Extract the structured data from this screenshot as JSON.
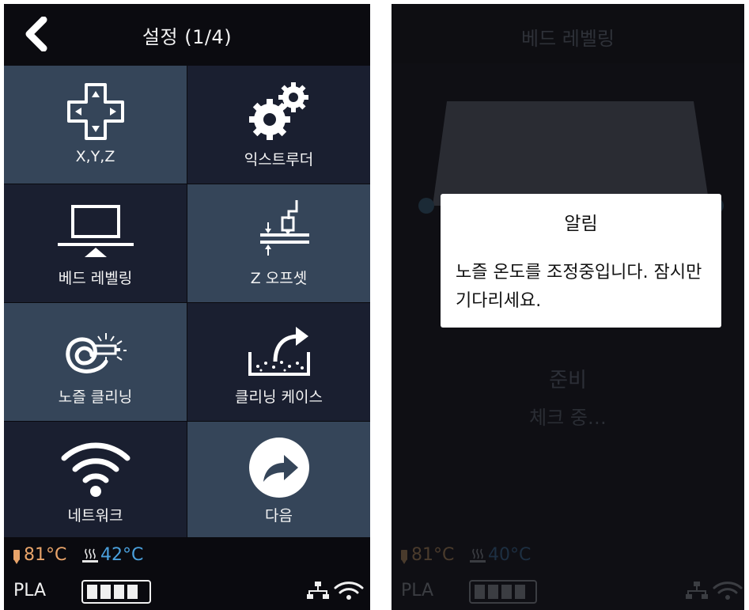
{
  "left_screen": {
    "header": {
      "title": "설정 (1/4)"
    },
    "tiles": [
      {
        "label": "X,Y,Z",
        "icon": "dpad-icon"
      },
      {
        "label": "익스트루더",
        "icon": "gears-icon"
      },
      {
        "label": "베드 레벨링",
        "icon": "bed-leveling-icon"
      },
      {
        "label": "Z 오프셋",
        "icon": "z-offset-icon"
      },
      {
        "label": "노즐 클리닝",
        "icon": "nozzle-cleaning-icon"
      },
      {
        "label": "클리닝 케이스",
        "icon": "cleaning-case-icon"
      },
      {
        "label": "네트워크",
        "icon": "wifi-icon"
      },
      {
        "label": "다음",
        "icon": "next-arrow-icon"
      }
    ],
    "status": {
      "nozzle_temp": "81°C",
      "bed_temp": "42°C",
      "material": "PLA",
      "filament_level": 1.0
    }
  },
  "right_screen": {
    "header": {
      "title": "베드 레벨링"
    },
    "state_title": "준비",
    "state_detail": "체크 중…",
    "dialog": {
      "title": "알림",
      "message": "노즐 온도를 조정중입니다. 잠시만 기다리세요."
    },
    "status": {
      "nozzle_temp": "81°C",
      "bed_temp": "40°C",
      "material": "PLA",
      "filament_level": 1.0
    }
  },
  "colors": {
    "tile_light": "#354559",
    "tile_dark": "#1a1f30",
    "nozzle_temp": "#e9a46a",
    "bed_temp": "#4aa0dd"
  }
}
